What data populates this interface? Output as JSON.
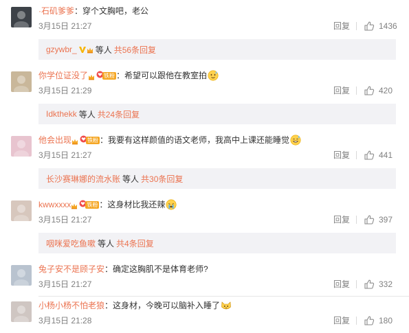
{
  "comments": [
    {
      "username": "·石矶爹爹",
      "badges": [],
      "colon": "：",
      "text": "穿个文胸吧，老公",
      "emoji": null,
      "time": "3月15日 21:27",
      "reply_label": "回复",
      "likes": "1436",
      "avatar_color": "#3d4248",
      "sub": {
        "user": "gzywbr_",
        "user_badges": [
          "v-badge",
          "vip-crown"
        ],
        "mid": "等人",
        "link": "共56条回复"
      }
    },
    {
      "username": "你学位证没了",
      "badges": [
        "vip-crown",
        "fan-badge"
      ],
      "colon": "：",
      "text": "希望可以跟他在教室拍",
      "emoji": "sweat-smile-emoji",
      "time": "3月15日 21:29",
      "reply_label": "回复",
      "likes": "420",
      "avatar_color": "#c9b79a",
      "sub": {
        "user": "Idkthekk",
        "user_badges": [],
        "mid": "等人",
        "link": "共24条回复"
      }
    },
    {
      "username": "他会出现",
      "badges": [
        "vip-crown",
        "fan-badge"
      ],
      "colon": "：",
      "text": "我要有这样颜值的语文老师，我高中上课还能睡觉",
      "emoji": "sweat-grin-emoji",
      "time": "3月15日 21:27",
      "reply_label": "回复",
      "likes": "441",
      "avatar_color": "#e8c4cf",
      "sub": {
        "user": "长沙赛琳娜的流水账",
        "user_badges": [],
        "mid": "等人",
        "link": "共30条回复"
      }
    },
    {
      "username": "kwwxxxx",
      "badges": [
        "vip-crown",
        "fan-badge"
      ],
      "colon": "：",
      "text": "这身材比我还辣",
      "emoji": "crying-emoji",
      "time": "3月15日 21:27",
      "reply_label": "回复",
      "likes": "397",
      "avatar_color": "#d7c7bd",
      "sub": {
        "user": "咽咪爱吃鱼嗽",
        "user_badges": [],
        "mid": "等人",
        "link": "共4条回复"
      }
    },
    {
      "username": "兔子安不是顾子安",
      "badges": [],
      "colon": "：",
      "text": "确定这胸肌不是体育老师?",
      "emoji": null,
      "time": "3月15日 21:27",
      "reply_label": "回复",
      "likes": "332",
      "avatar_color": "#b9c3cf",
      "sub": null
    },
    {
      "username": "小杨小杨不怕老狼",
      "badges": [],
      "colon": "：",
      "text": "这身材，今晚可以脑补入睡了",
      "emoji": "kitty-emoji",
      "time": "3月15日 21:28",
      "reply_label": "回复",
      "likes": "180",
      "avatar_color": "#cfc6c2",
      "sub": null
    }
  ],
  "fan_badge_text": "铁粉",
  "colors": {
    "username": "#eb7350",
    "meta": "#808080",
    "sub_bg": "#f2f2f5",
    "vip": "#f5a623",
    "v_badge": "#f7b500"
  }
}
